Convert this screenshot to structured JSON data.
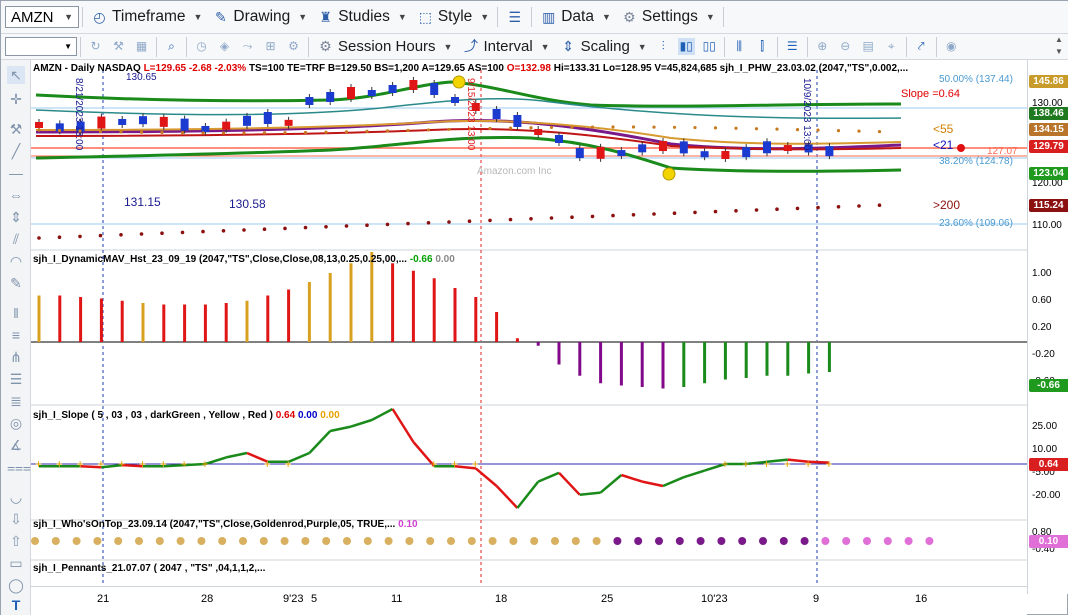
{
  "toolbar1": {
    "symbol": "AMZN",
    "timeframe": "Timeframe",
    "drawing": "Drawing",
    "studies": "Studies",
    "style": "Style",
    "data": "Data",
    "settings": "Settings"
  },
  "toolbar2": {
    "session_hours": "Session Hours",
    "interval": "Interval",
    "scaling": "Scaling"
  },
  "price_header": "AMZN - Daily  NASDAQ",
  "price_L": "L=129.65",
  "price_chg": "-2.68",
  "price_pct": "-2.03%",
  "price_rest": "TS=100  TE=TRF  B=129.50  BS=1,200  A=129.65  AS=100",
  "price_O": "O=132.98",
  "price_tail": "Hi=133.31  Lo=128.95  V=45,824,685  sjh_I_PHW_23.03.02 (2047,\"TS\",0.002,...",
  "study1_header": "sjh_I_DynamicMAV_Hst_23_09_19 (2047,\"TS\",Close,Close,08,13,0.25,0.25,00,...",
  "study1_v1": "-0.66",
  "study1_v2": "0.00",
  "study2_header": "sjh_I_Slope ( 5 , 03 , 03 , darkGreen , Yellow , Red )",
  "study2_v1": "0.64",
  "study2_v2": "0.00",
  "study2_v3": "0.00",
  "study3_header": "sjh_I_Who'sOnTop_23.09.14 (2047,\"TS\",Close,Goldenrod,Purple,05,  TRUE,...",
  "study3_v1": "0.10",
  "study4_header": "sjh_I_Pennants_21.07.07 (  2047 ,  \"TS\" ,04,1,1,2,...",
  "annotations": {
    "slope": "Slope =0.64",
    "lt55": "<55",
    "lt21": "<21",
    "gt200": ">200",
    "fib50": "50.00% (137.44)",
    "fib38": "38.20% (124.78)",
    "fib23": "23.60% (109.06)",
    "lvl12707": "127.07",
    "v13115": "131.15",
    "v13058": "130.58",
    "amazon": "Amazon.com Inc",
    "v13065": "130.65",
    "vline1": "8/21/2023  13:00",
    "vline2": "9/15/2023  13:00",
    "vline3": "10/9/2023  13:00"
  },
  "axis": {
    "price_tags": [
      {
        "value": "145.86",
        "color": "#c89b2a"
      },
      {
        "value": "138.46",
        "color": "#1f7a1f"
      },
      {
        "value": "134.15",
        "color": "#b8742a"
      },
      {
        "value": "129.79",
        "color": "#d81e1e"
      },
      {
        "value": "123.04",
        "color": "#1f9a1f"
      },
      {
        "value": "115.24",
        "color": "#8b1010"
      }
    ],
    "price_ticks": [
      "130.00",
      "120.00",
      "110.00"
    ],
    "hist_ticks": [
      "1.00",
      "0.60",
      "0.20",
      "-0.20",
      "-0.60"
    ],
    "hist_tag": "-0.66",
    "slope_ticks": [
      "25.00",
      "10.00",
      "-5.00",
      "-20.00"
    ],
    "slope_tag": "0.64",
    "who_ticks": [
      "0.80",
      "-0.40"
    ],
    "who_tag": "0.10"
  },
  "dates": [
    "21",
    "28",
    "9'23",
    "5",
    "11",
    "18",
    "25",
    "10'23",
    "9",
    "16"
  ],
  "chart_data": {
    "type": "bar",
    "series": [
      {
        "values": [
          0.62,
          0.62,
          0.6,
          0.58,
          0.55,
          0.52,
          0.5,
          0.5,
          0.5,
          0.52,
          0.55,
          0.62,
          0.7,
          0.8,
          0.92,
          1.05,
          1.2,
          1.05,
          0.95,
          0.85,
          0.72,
          0.6,
          0.4,
          0.05,
          -0.05,
          -0.3,
          -0.45,
          -0.55,
          -0.58,
          -0.6,
          -0.62,
          -0.6,
          -0.55,
          -0.5,
          -0.48,
          -0.45,
          -0.45,
          -0.42,
          -0.4
        ]
      },
      {
        "values": [
          -1,
          -1,
          -1,
          -1.5,
          -0.5,
          -1,
          -1,
          -0.5,
          0,
          3,
          5,
          1,
          1,
          5,
          15,
          17,
          20,
          25,
          10,
          -1,
          -1,
          -2,
          -10,
          -20,
          -8,
          -4,
          -14,
          -13,
          -5,
          -8,
          -10,
          -6,
          -3,
          0,
          0,
          1,
          2,
          1,
          0.64
        ]
      }
    ]
  }
}
